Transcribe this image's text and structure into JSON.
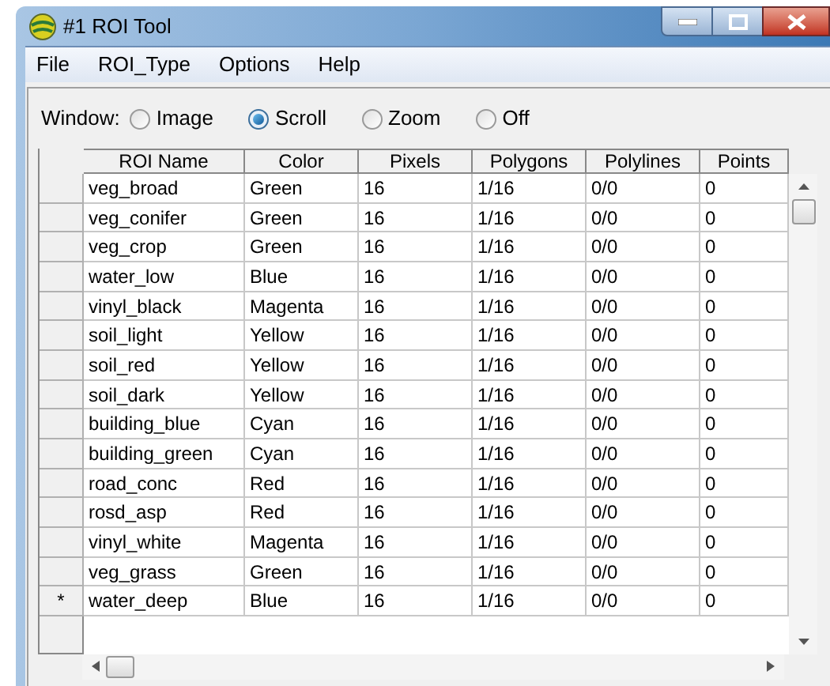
{
  "window": {
    "title": "#1 ROI Tool"
  },
  "menu": [
    "File",
    "ROI_Type",
    "Options",
    "Help"
  ],
  "window_mode": {
    "label": "Window:",
    "options": [
      {
        "label": "Image",
        "selected": false
      },
      {
        "label": "Scroll",
        "selected": true
      },
      {
        "label": "Zoom",
        "selected": false
      },
      {
        "label": "Off",
        "selected": false
      }
    ]
  },
  "table": {
    "columns": [
      "ROI Name",
      "Color",
      "Pixels",
      "Polygons",
      "Polylines",
      "Points"
    ],
    "rows": [
      {
        "cells": [
          "veg_broad",
          "Green",
          "16",
          "1/16",
          "0/0",
          "0"
        ]
      },
      {
        "cells": [
          "veg_conifer",
          "Green",
          "16",
          "1/16",
          "0/0",
          "0"
        ]
      },
      {
        "cells": [
          "veg_crop",
          "Green",
          "16",
          "1/16",
          "0/0",
          "0"
        ]
      },
      {
        "cells": [
          "water_low",
          "Blue",
          "16",
          "1/16",
          "0/0",
          "0"
        ]
      },
      {
        "cells": [
          "vinyl_black",
          "Magenta",
          "16",
          "1/16",
          "0/0",
          "0"
        ]
      },
      {
        "cells": [
          "soil_light",
          "Yellow",
          "16",
          "1/16",
          "0/0",
          "0"
        ]
      },
      {
        "cells": [
          "soil_red",
          "Yellow",
          "16",
          "1/16",
          "0/0",
          "0"
        ]
      },
      {
        "cells": [
          "soil_dark",
          "Yellow",
          "16",
          "1/16",
          "0/0",
          "0"
        ]
      },
      {
        "cells": [
          "building_blue",
          "Cyan",
          "16",
          "1/16",
          "0/0",
          "0"
        ]
      },
      {
        "cells": [
          "building_green",
          "Cyan",
          "16",
          "1/16",
          "0/0",
          "0"
        ]
      },
      {
        "cells": [
          "road_conc",
          "Red",
          "16",
          "1/16",
          "0/0",
          "0"
        ]
      },
      {
        "cells": [
          "rosd_asp",
          "Red",
          "16",
          "1/16",
          "0/0",
          "0"
        ]
      },
      {
        "cells": [
          "vinyl_white",
          "Magenta",
          "16",
          "1/16",
          "0/0",
          "0"
        ]
      },
      {
        "cells": [
          "veg_grass",
          "Green",
          "16",
          "1/16",
          "0/0",
          "0"
        ]
      },
      {
        "marker": "*",
        "cells": [
          "water_deep",
          "Blue",
          "16",
          "1/16",
          "0/0",
          "0"
        ]
      }
    ]
  }
}
